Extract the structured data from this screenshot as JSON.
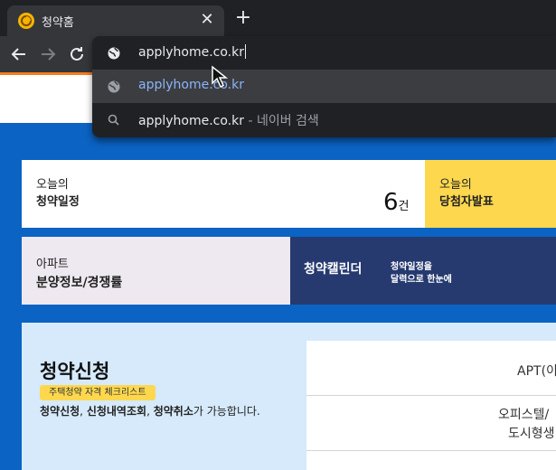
{
  "browser": {
    "tab": {
      "title": "청약홈",
      "close": "✕"
    },
    "new_tab": "+",
    "omnibox": {
      "value": "applyhome.co.kr",
      "suggestions": [
        {
          "text": "applyhome.co.kr",
          "type": "url"
        },
        {
          "text": "applyhome.co.kr",
          "separator": " - ",
          "suffix": "네이버 검색",
          "type": "search"
        }
      ]
    }
  },
  "page": {
    "today": {
      "small": "오늘의",
      "title": "청약일정",
      "count": "6",
      "unit": "건"
    },
    "winner": {
      "small": "오늘의",
      "title": "당첨자발표"
    },
    "apt": {
      "small": "아파트",
      "title": "분양정보/경쟁률"
    },
    "calendar": {
      "title": "청약캘린더",
      "desc_line1": "청약일정을",
      "desc_line2": "달력으로 한눈에"
    },
    "apply": {
      "title": "청약신청",
      "badge": "주택청약 자격 체크리스트",
      "desc_parts": [
        "청약신청",
        ", ",
        "신청내역조회",
        ", ",
        "청약취소",
        "가 가능합니다."
      ],
      "table": {
        "row1": "APT(이",
        "row2_line1": "오피스텔/",
        "row2_line2": "도시형생"
      }
    }
  },
  "colors": {
    "accent_blue": "#0b63c4",
    "yellow": "#fdd84f",
    "navy": "#263a70",
    "orange": "#f47c20"
  }
}
